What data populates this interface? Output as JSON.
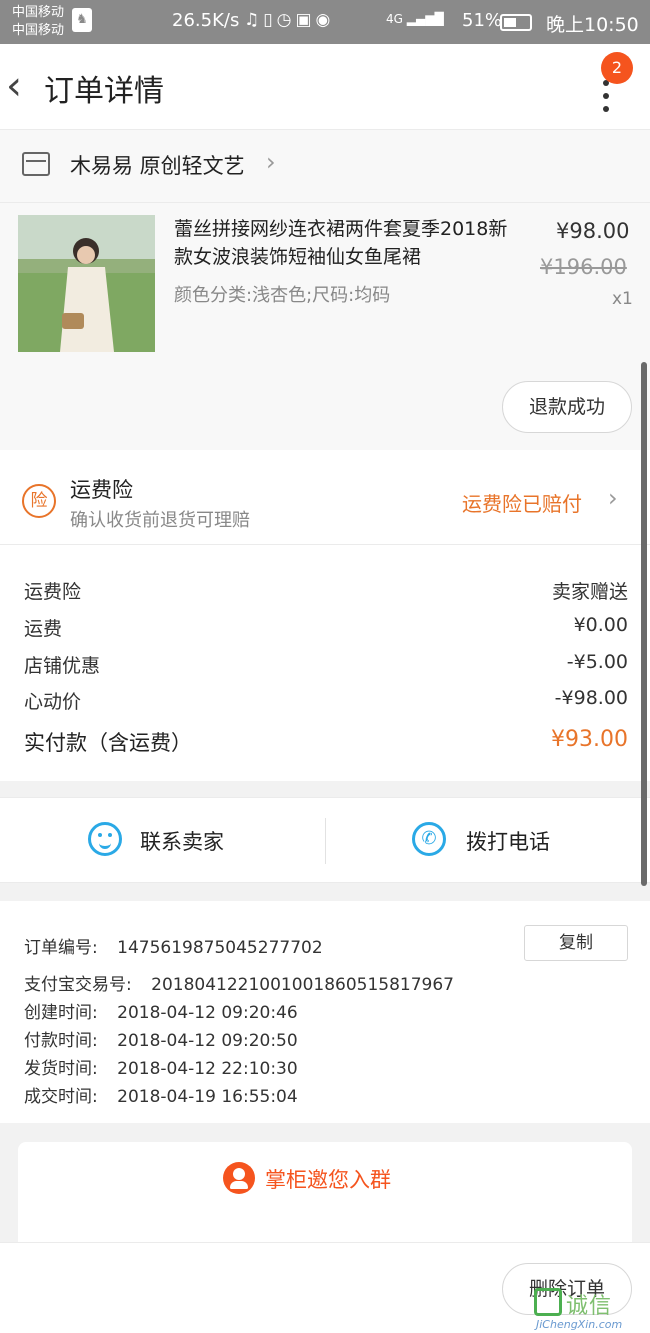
{
  "status_bar": {
    "carrier_1": "中国移动",
    "carrier_2": "中国移动",
    "net_speed": "26.5K/s",
    "icons": [
      "headphones-icon",
      "vibrate-icon",
      "alarm-icon",
      "hd-icon",
      "eye-icon",
      "signal-icon"
    ],
    "signal_label": "4G",
    "battery_pct": "51%",
    "battery_level": 0.51,
    "time": "晚上10:50"
  },
  "nav": {
    "title": "订单详情",
    "badge_count": "2"
  },
  "shop": {
    "name": "木易易 原创轻文艺"
  },
  "product": {
    "title": "蕾丝拼接网纱连衣裙两件套夏季2018新款女波浪装饰短袖仙女鱼尾裙",
    "spec": "颜色分类:浅杏色;尺码:均码",
    "price": "¥98.00",
    "original_price": "¥196.00",
    "quantity": "x1",
    "refund_label": "退款成功"
  },
  "insurance": {
    "icon_label": "险",
    "title": "运费险",
    "subtitle": "确认收货前退货可理赔",
    "status": "运费险已赔付"
  },
  "fees": [
    {
      "label": "运费险",
      "value": "卖家赠送"
    },
    {
      "label": "运费",
      "value": "¥0.00"
    },
    {
      "label": "店铺优惠",
      "value": "-¥5.00"
    },
    {
      "label": "心动价",
      "value": "-¥98.00"
    }
  ],
  "total": {
    "label": "实付款（含运费）",
    "value": "¥93.00"
  },
  "contact": {
    "seller_label": "联系卖家",
    "phone_label": "拨打电话"
  },
  "order_info": {
    "order_no_label": "订单编号:",
    "order_no": "1475619875045277702",
    "copy_label": "复制",
    "alipay_label": "支付宝交易号:",
    "alipay_no": "2018041221001001860515817967",
    "created_label": "创建时间:",
    "created": "2018-04-12 09:20:46",
    "paid_label": "付款时间:",
    "paid": "2018-04-12 09:20:50",
    "shipped_label": "发货时间:",
    "shipped": "2018-04-12 22:10:30",
    "completed_label": "成交时间:",
    "completed": "2018-04-19 16:55:04"
  },
  "group": {
    "title": "掌柜邀您入群"
  },
  "bottom": {
    "delete_label": "删除订单"
  },
  "watermark": {
    "text": "诚信",
    "url": "JiChengXin.com"
  },
  "colors": {
    "accent_orange": "#e8742a",
    "badge_red": "#f5541e",
    "icon_blue": "#2aa9e6"
  }
}
